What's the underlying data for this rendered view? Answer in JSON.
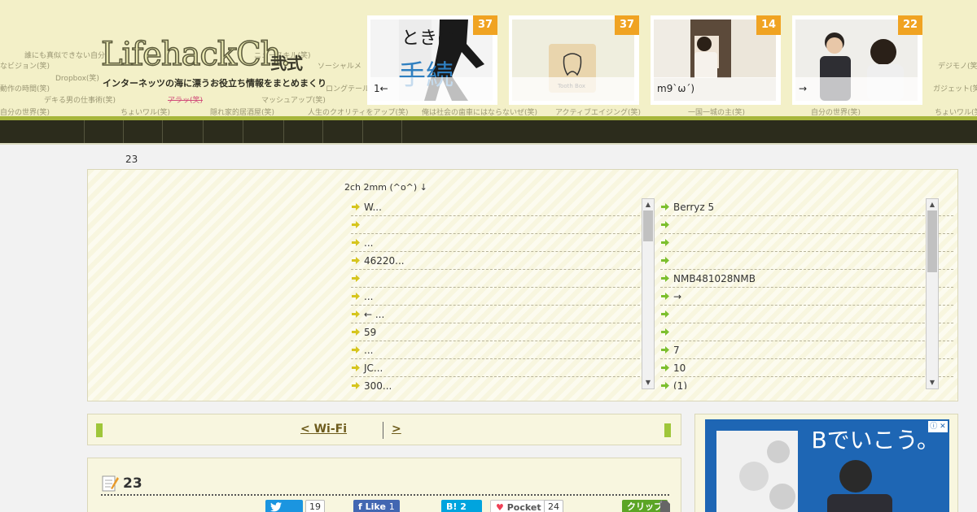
{
  "header": {
    "logo_text": "LifehackCh.",
    "logo_kanji": "弐式",
    "tagline": "インターネッツの海に漂うお役立ち情報をまとめまくり",
    "tag_cloud": [
      "誰にも真似できない自分",
      "なビジョン(笑)",
      "Dropbox(笑)",
      "動作の時間(笑)",
      "デキる男の仕事術(笑)",
      "自分の世界(笑)",
      "ちょいワル(笑)",
      "アラッ(笑)",
      "隠れ家的居酒屋(笑)",
      "マッシュアップ(笑)",
      "人生のクオリティをアップ(笑)",
      "俺は社会の歯車にはならないぜ(笑)",
      "アクティブエイジング(笑)",
      "一国一城の主(笑)",
      "自分の世界(笑)",
      "ちょいワル(笑)",
      "デジモノ(笑)",
      "ガジェット(笑)",
      "ソーシャルメ",
      "ロングテール",
      "ニュースキル(笑)"
    ],
    "thumbs": [
      {
        "count": "37",
        "caption": "1←"
      },
      {
        "count": "37",
        "caption": ""
      },
      {
        "count": "14",
        "caption": "m9`ω´)"
      },
      {
        "count": "22",
        "caption": "→"
      }
    ]
  },
  "main": {
    "counter": "23",
    "panel_title": "2ch  2mm (^o^) ↓",
    "left_list": [
      "W...",
      "",
      "...",
      "46220...",
      "",
      "...",
      "← ...",
      "59",
      "...",
      "JC...",
      "300..."
    ],
    "right_list": [
      "Berryz 5",
      "",
      "",
      "",
      "NMB481028NMB",
      "→",
      "",
      "",
      "7",
      "10",
      "(1)"
    ]
  },
  "pager": {
    "prev_label": "< Wi-Fi",
    "next_label": ">"
  },
  "article": {
    "title": "23",
    "tweet_count": "19",
    "like_label": "Like",
    "like_count": "1",
    "hatena_label": "B!",
    "hatena_count": "2",
    "pocket_label": "Pocket",
    "pocket_count": "24",
    "clip_label": "クリップ"
  },
  "ad": {
    "text": "Bでいこう。",
    "close": "ⓘ ✕"
  },
  "colors": {
    "header_bg": "#f3f0c8",
    "nav_bg": "#2c2c1c",
    "accent_green": "#9fc63a",
    "badge_orange": "#f0a322",
    "panel_bg": "#f8f6df"
  }
}
